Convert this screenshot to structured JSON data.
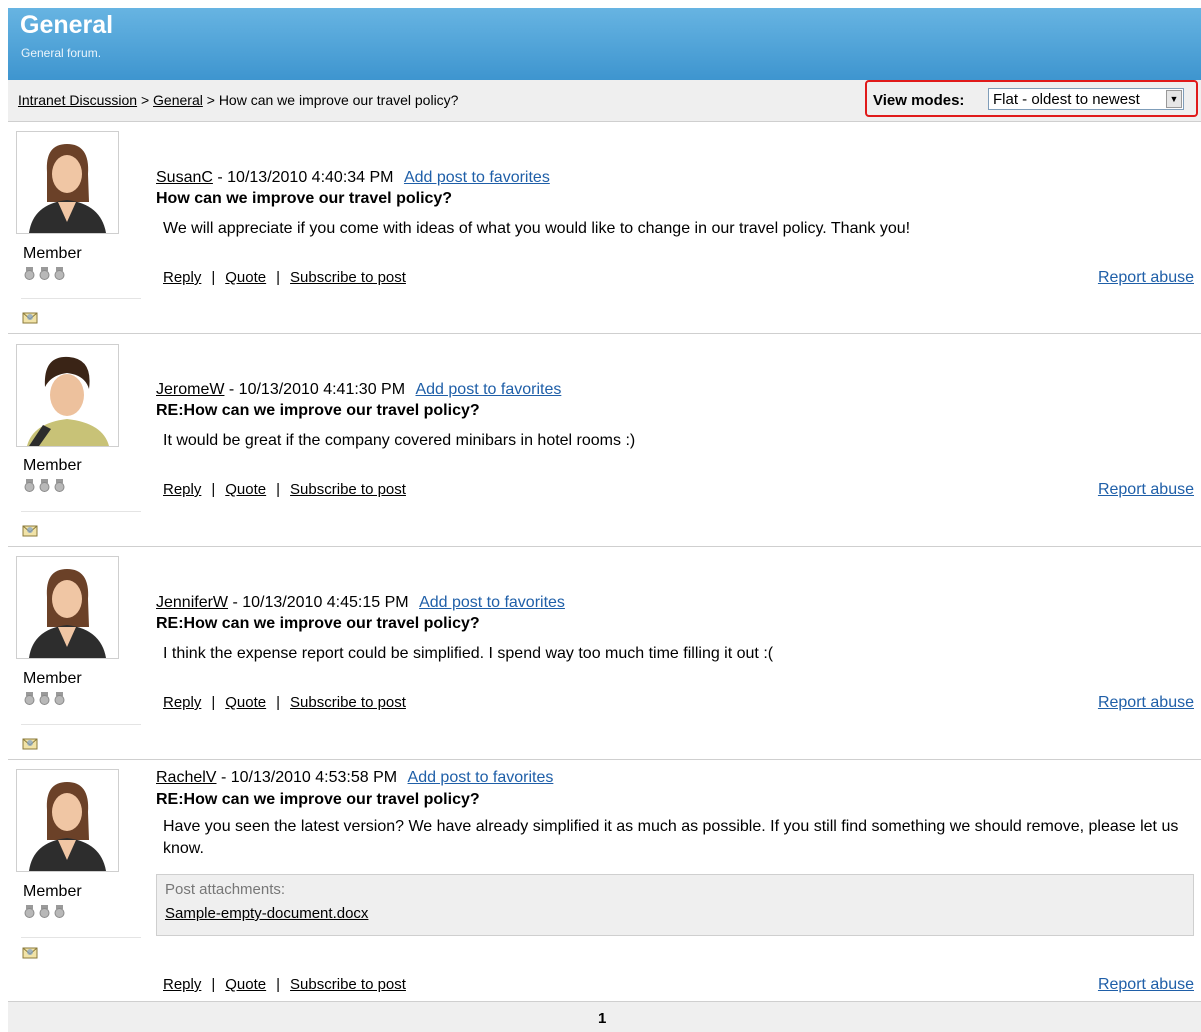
{
  "header": {
    "title": "General",
    "subtitle": "General forum."
  },
  "breadcrumb": {
    "items": [
      "Intranet Discussion",
      "General"
    ],
    "separator": ">",
    "current": "How can we improve our travel policy?"
  },
  "view_modes": {
    "label": "View modes:",
    "selected": "Flat - oldest to newest"
  },
  "colors": {
    "header_blue": "#4aa2d8",
    "link_blue": "#1f5fa8",
    "highlight_red": "#e01a1a"
  },
  "actions": {
    "reply": "Reply",
    "quote": "Quote",
    "subscribe": "Subscribe to post",
    "separator": "|",
    "report": "Report abuse",
    "favorite": "Add post to favorites"
  },
  "posts": [
    {
      "user": "SusanC",
      "date": "- 10/13/2010 4:40:34 PM",
      "subject": "How can we improve our travel policy?",
      "body": "We will appreciate if you come with ideas of what you would like to change in our travel policy. Thank you!",
      "role": "Member",
      "avatar": "female-avatar-icon"
    },
    {
      "user": "JeromeW",
      "date": "- 10/13/2010 4:41:30 PM",
      "subject": "RE:How can we improve our travel policy?",
      "body": "It would be great if the company covered minibars in hotel rooms :)",
      "role": "Member",
      "avatar": "male-avatar-icon"
    },
    {
      "user": "JenniferW",
      "date": "- 10/13/2010 4:45:15 PM",
      "subject": "RE:How can we improve our travel policy?",
      "body": "I think the expense report could be simplified. I spend way too much time filling it out :(",
      "role": "Member",
      "avatar": "female-avatar-icon"
    },
    {
      "user": "RachelV",
      "date": "- 10/13/2010 4:53:58 PM",
      "subject": "RE:How can we improve our travel policy?",
      "body": "Have you seen the latest version? We have already simplified it as much as possible. If you still find something we should remove, please let us know.",
      "role": "Member",
      "avatar": "female-avatar-icon",
      "attachments": {
        "label": "Post attachments:",
        "file": "Sample-empty-document.docx"
      }
    }
  ],
  "pager": {
    "current_page": "1"
  }
}
